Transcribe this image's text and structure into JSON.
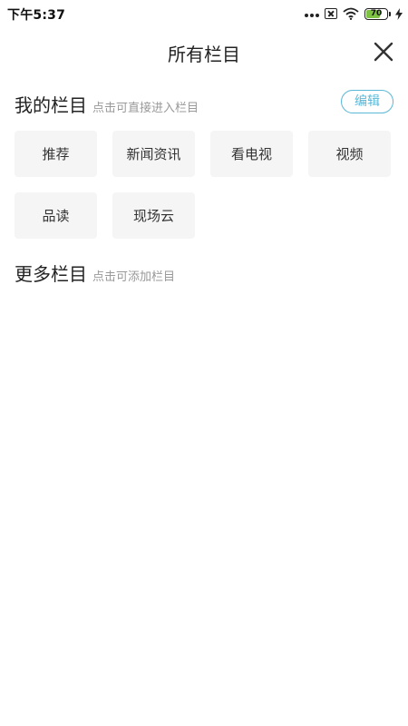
{
  "status_bar": {
    "time": "下午5:37",
    "battery_level": "70",
    "battery_fraction": 0.7,
    "icons": [
      "more-dots-icon",
      "no-sim-icon",
      "wifi-icon",
      "battery-icon",
      "charging-bolt-icon"
    ]
  },
  "header": {
    "title": "所有栏目",
    "close_icon": "close-icon"
  },
  "my_channels": {
    "title": "我的栏目",
    "hint": "点击可直接进入栏目",
    "edit_label": "编辑",
    "items": [
      "推荐",
      "新闻资讯",
      "看电视",
      "视频",
      "品读",
      "现场云"
    ]
  },
  "more_channels": {
    "title": "更多栏目",
    "hint": "点击可添加栏目"
  },
  "colors": {
    "accent": "#5bb8d6",
    "tile_bg": "#f5f5f5",
    "battery_fill": "#7dc243"
  }
}
